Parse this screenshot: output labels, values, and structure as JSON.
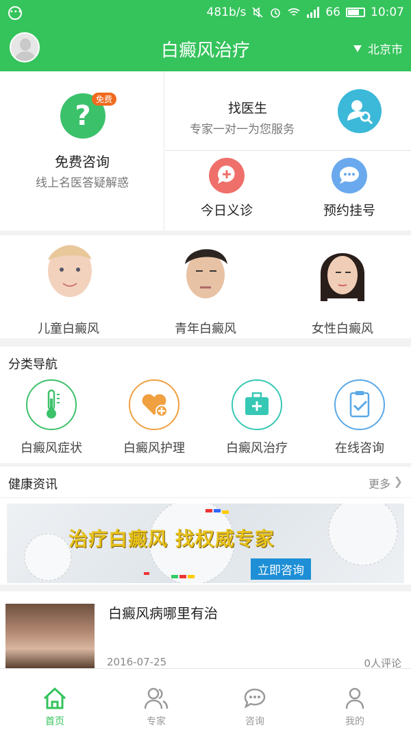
{
  "status_bar": {
    "speed": "481b/s",
    "battery": "66",
    "time": "10:07"
  },
  "header": {
    "title": "白癜风治疗",
    "city": "北京市"
  },
  "features": {
    "free_consult": {
      "badge": "免费",
      "title": "免费咨询",
      "subtitle": "线上名医答疑解惑"
    },
    "find_doctor": {
      "title": "找医生",
      "subtitle": "专家一对一为您服务"
    },
    "clinic_today": {
      "label": "今日义诊"
    },
    "appointment": {
      "label": "预约挂号"
    }
  },
  "people": [
    {
      "label": "儿童白癜风"
    },
    {
      "label": "青年白癜风"
    },
    {
      "label": "女性白癜风"
    }
  ],
  "nav": {
    "title": "分类导航",
    "items": [
      {
        "label": "白癜风症状",
        "color": "#3cc16b"
      },
      {
        "label": "白癜风护理",
        "color": "#f0a040"
      },
      {
        "label": "白癜风治疗",
        "color": "#36c8b4"
      },
      {
        "label": "在线咨询",
        "color": "#5aa8e6"
      }
    ]
  },
  "news": {
    "title": "健康资讯",
    "more": "更多"
  },
  "banner": {
    "text": "治疗白癜风  找权威专家",
    "button": "立即咨询"
  },
  "article": {
    "title": "白癜风病哪里有治",
    "date": "2016-07-25",
    "comments": "0人评论"
  },
  "tabs": [
    {
      "label": "首页",
      "active": true
    },
    {
      "label": "专家",
      "active": false
    },
    {
      "label": "咨询",
      "active": false
    },
    {
      "label": "我的",
      "active": false
    }
  ],
  "colors": {
    "brand_green": "#35c35c"
  }
}
